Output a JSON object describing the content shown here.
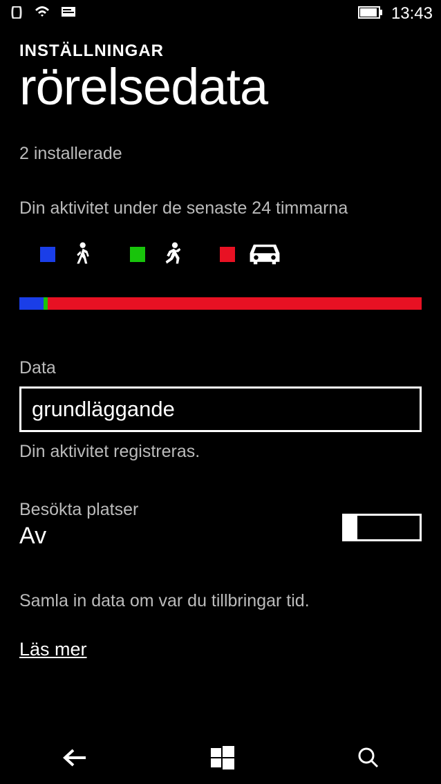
{
  "status": {
    "time": "13:43"
  },
  "header": {
    "category": "INSTÄLLNINGAR",
    "title": "rörelsedata"
  },
  "apps": {
    "installed_text": "2 installerade"
  },
  "activity": {
    "label": "Din aktivitet under de senaste 24 timmarna",
    "legend": {
      "walk_color": "#1a3ee8",
      "run_color": "#18c40b",
      "drive_color": "#e81123"
    },
    "bar": {
      "blue_pct": 6,
      "green_pct": 1,
      "red_pct": 93
    }
  },
  "data_section": {
    "label": "Data",
    "selected": "grundläggande",
    "note": "Din aktivitet registreras."
  },
  "places": {
    "label": "Besökta platser",
    "value": "Av",
    "description": "Samla in data om var du tillbringar tid.",
    "learn_more": "Läs mer"
  }
}
